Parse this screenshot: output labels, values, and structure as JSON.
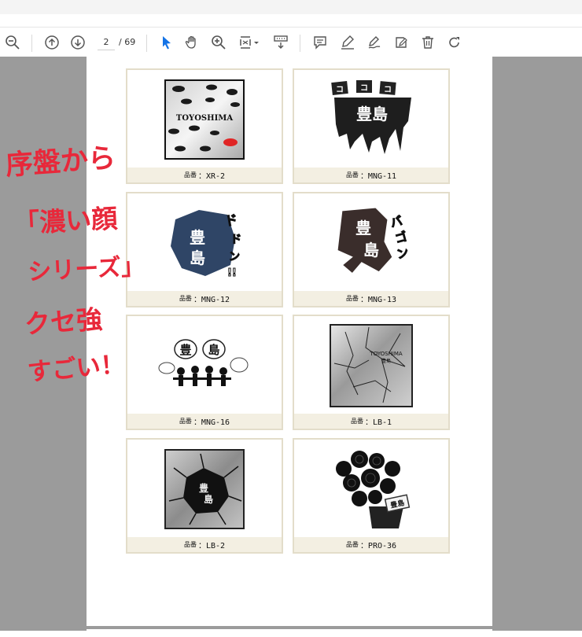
{
  "toolbar": {
    "current_page": "2",
    "page_sep": "/",
    "total_pages": "69"
  },
  "products": [
    {
      "label": "品番",
      "code": "：XR-2",
      "image_text": "TOYOSHIMA"
    },
    {
      "label": "品番",
      "code": "：MNG-11",
      "image_text": "豊島"
    },
    {
      "label": "品番",
      "code": "：MNG-12",
      "image_text": "豊島"
    },
    {
      "label": "品番",
      "code": "：MNG-13",
      "image_text": "豊島"
    },
    {
      "label": "品番",
      "code": "：MNG-16",
      "image_text": "豊島"
    },
    {
      "label": "品番",
      "code": "：LB-1",
      "image_text": "TOYOSHIMA"
    },
    {
      "label": "品番",
      "code": "：LB-2",
      "image_text": "豊島"
    },
    {
      "label": "品番",
      "code": "：PRO-36",
      "image_text": "豊島"
    }
  ],
  "handwriting": {
    "line1": "序盤から",
    "line2": "「濃い顔",
    "line3": "シリーズ」",
    "line4": "クセ強",
    "line5": "すごい！",
    "color": "#e8283a"
  }
}
